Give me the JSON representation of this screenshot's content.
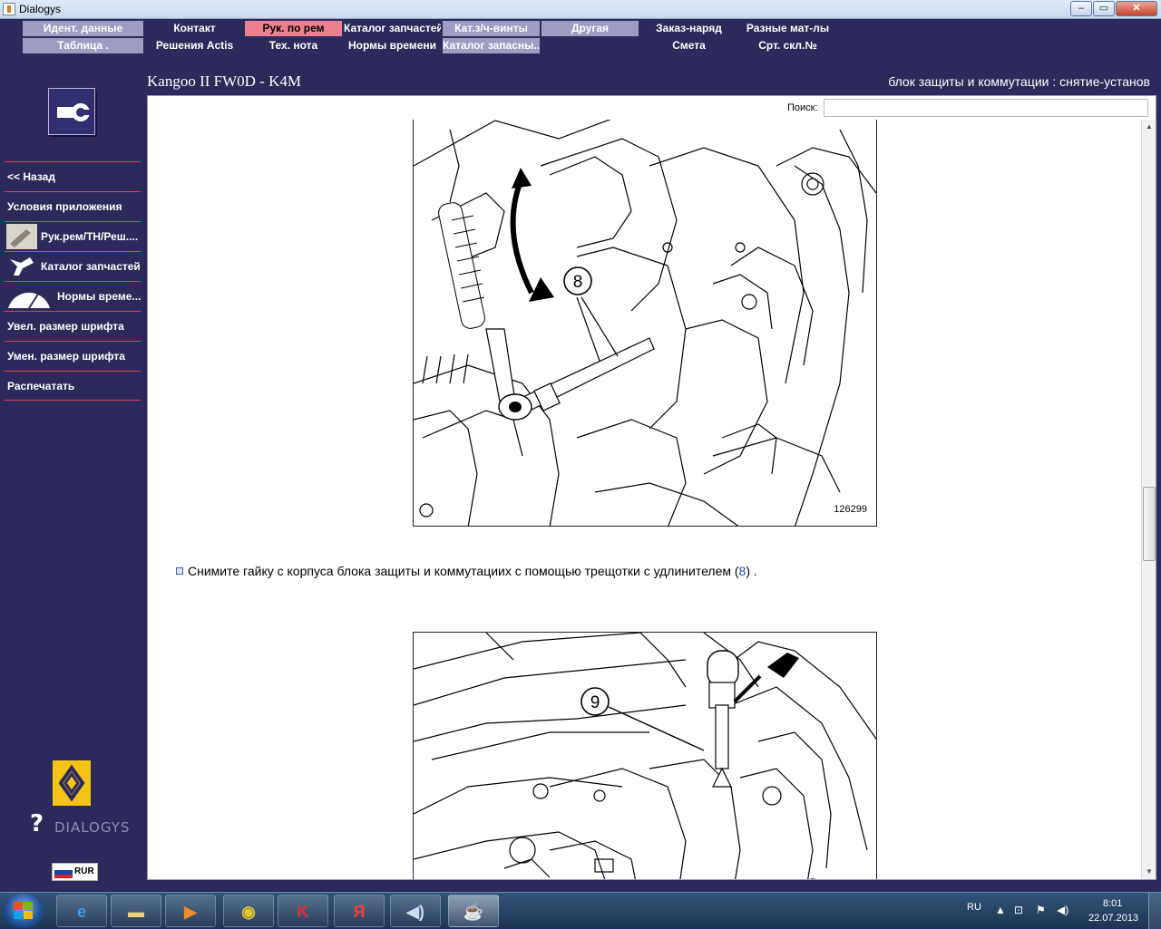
{
  "window": {
    "title": "Dialogys",
    "min": "–",
    "max": "▭",
    "close": "✕"
  },
  "menu": {
    "row1": [
      "Идент. данные",
      "Контакт",
      "Рук. по рем",
      "Каталог запчастей",
      "Кат.з/ч-винты",
      "Другая",
      "Заказ-наряд",
      "Разные мат-лы"
    ],
    "row2": [
      "Таблица .",
      "Решения Actis",
      "Тех. нота",
      "Нормы времени",
      "Каталог запасны...",
      "",
      "Смета",
      "Срт. скл.№"
    ],
    "active": "Рук. по рем"
  },
  "sidebar": {
    "tool_logo_icon": "wrench-icon",
    "items": [
      "<< Назад",
      "Условия приложения",
      "Рук.рем/ТН/Реш....",
      "Каталог запчастей",
      "Нормы време...",
      "Увел. размер шрифта",
      "Умен. размер шрифта",
      "Распечатать"
    ],
    "brand": "DIALOGYS",
    "language": "RUR"
  },
  "header": {
    "vehicle": "Kangoo II FW0D - K4M",
    "section": "блок защиты и коммутации : снятие-установ"
  },
  "search": {
    "label": "Поиск:",
    "value": ""
  },
  "document": {
    "figure1": {
      "callout": "8",
      "number": "126299"
    },
    "instruction": {
      "text": "Снимите гайку с корпуса блока защиты и коммутациих с помощью трещотки с удлинителем (",
      "ref": "8",
      "tail": ") ."
    },
    "figure2": {
      "callout": "9"
    }
  },
  "taskbar": {
    "apps": [
      "ie-icon",
      "explorer-icon",
      "media-player-icon",
      "chrome-icon",
      "kaspersky-icon",
      "yandex-icon",
      "audio-icon",
      "java-icon"
    ],
    "tray_lang": "RU",
    "time": "8:01",
    "date": "22.07.2013"
  },
  "colors": {
    "app_bg": "#2b2a5b",
    "menu_btn": "#9d9cc2",
    "menu_active": "#ee7f8e",
    "divider": "#e0404f"
  }
}
